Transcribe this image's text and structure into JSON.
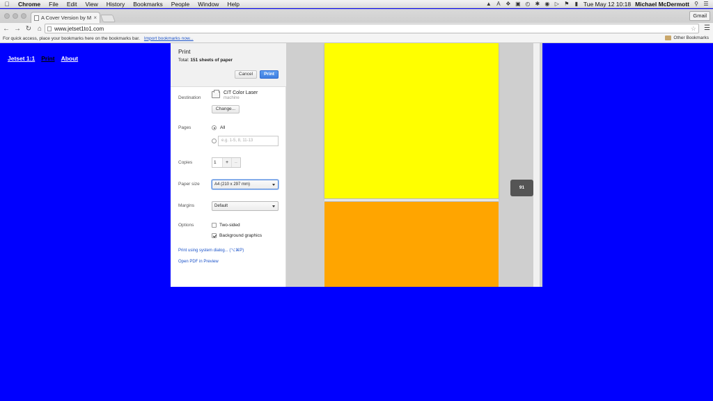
{
  "menubar": {
    "app": "Chrome",
    "items": [
      "File",
      "Edit",
      "View",
      "History",
      "Bookmarks",
      "People",
      "Window",
      "Help"
    ],
    "clock": "Tue May 12  10:18",
    "user": "Michael McDermott"
  },
  "browser": {
    "tab_title": "A Cover Version by Michael",
    "url": "www.jetset1to1.com",
    "profile_label": "Gmail",
    "bookmarks_hint": "For quick access, place your bookmarks here on the bookmarks bar.",
    "import_link": "Import bookmarks now...",
    "other_bookmarks": "Other Bookmarks"
  },
  "site": {
    "nav": [
      "Jetset 1:1",
      "Print",
      "About"
    ]
  },
  "print": {
    "title": "Print",
    "total_prefix": "Total: ",
    "total_value": "151 sheets of paper",
    "cancel": "Cancel",
    "print": "Print",
    "destination_label": "Destination",
    "printer_name": "CIT Color Laser",
    "printer_sub": "machine",
    "change": "Change...",
    "pages_label": "Pages",
    "pages_all": "All",
    "pages_placeholder": "e.g. 1-5, 8, 11-13",
    "copies_label": "Copies",
    "copies_value": "1",
    "plus": "+",
    "minus": "–",
    "paper_size_label": "Paper size",
    "paper_size_value": "A4 (210 x 297 mm)",
    "margins_label": "Margins",
    "margins_value": "Default",
    "options_label": "Options",
    "two_sided": "Two-sided",
    "background_graphics": "Background graphics",
    "system_dialog_link": "Print using system dialog... (⌥⌘P)",
    "open_pdf_link": "Open PDF in Preview",
    "page_indicator": "91"
  },
  "colors": {
    "page_background": "#0000ff",
    "sheet_1": "#ffff00",
    "sheet_2": "#ffa500",
    "print_button": "#4285f4"
  }
}
